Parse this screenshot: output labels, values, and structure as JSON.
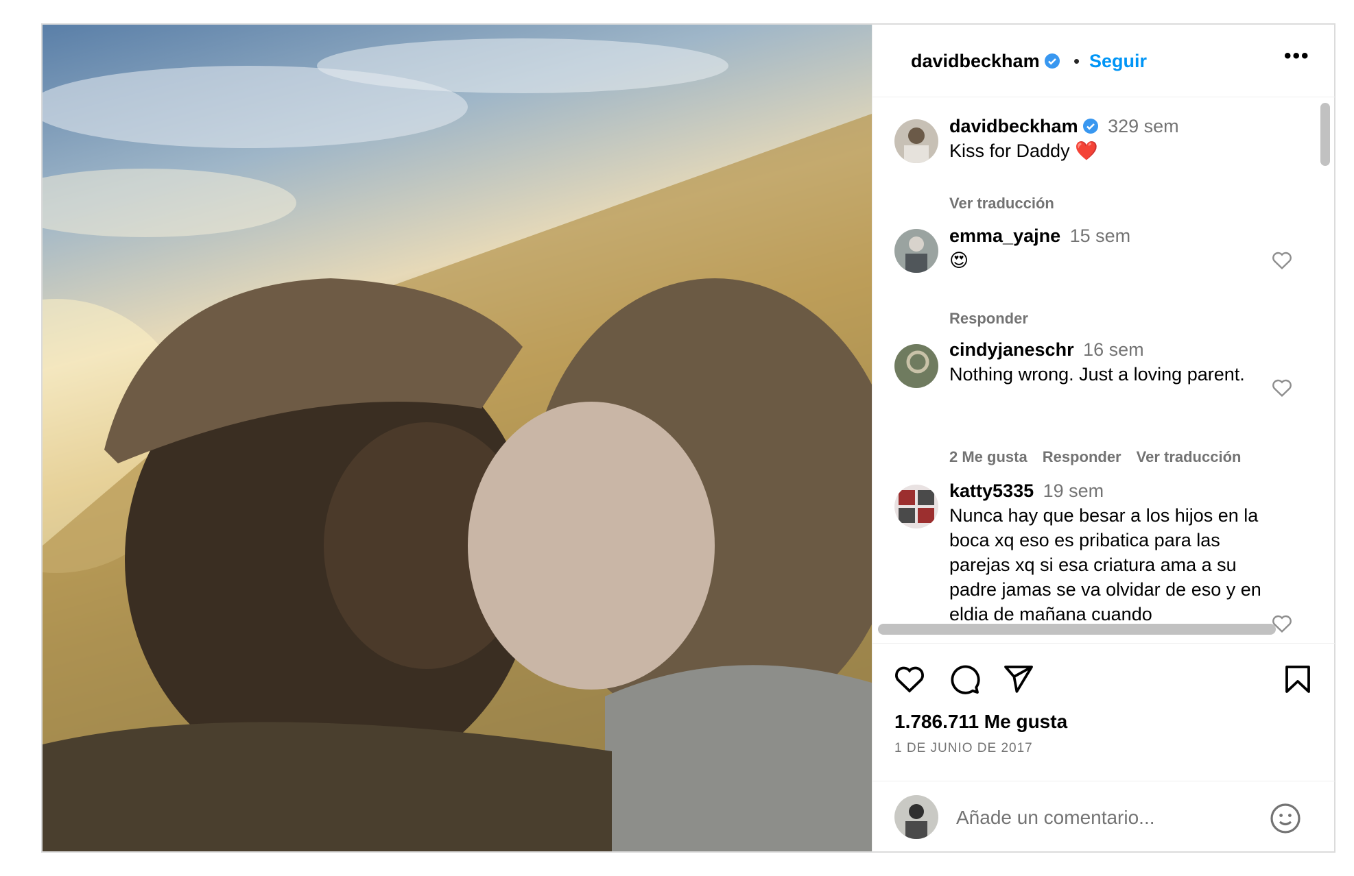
{
  "post": {
    "author": "davidbeckham",
    "separator": "•",
    "follow_label": "Seguir",
    "more_label": "•••"
  },
  "comments": [
    {
      "user": "davidbeckham",
      "time": "329 sem",
      "text": "Kiss for Daddy ❤️",
      "actions": [
        "Ver traducción"
      ],
      "verified": true
    },
    {
      "user": "emma_yajne",
      "time": "15 sem",
      "text": "😍",
      "actions": [
        "Responder"
      ]
    },
    {
      "user": "cindyjaneschr",
      "time": "16 sem",
      "text": "Nothing wrong. Just a loving parent.",
      "actions": [
        "2 Me gusta",
        "Responder",
        "Ver traducción"
      ]
    },
    {
      "user": "katty5335",
      "time": "19 sem",
      "text": "Nunca hay que besar a los hijos en la boca xq eso es pribatica para las parejas xq si esa criatura ama a su padre jamas se va olvidar de eso y en eldia de mañana cuando"
    }
  ],
  "footer": {
    "likes": "1.786.711 Me gusta",
    "date": "1 DE JUNIO DE 2017",
    "comment_placeholder": "Añade un comentario..."
  },
  "icons": [
    "heart-icon",
    "comment-icon",
    "share-icon",
    "bookmark-icon",
    "emoji-icon",
    "verified-badge-icon"
  ],
  "colors": {
    "link": "#0095f6",
    "verified": "#3897f0",
    "muted": "#737373",
    "border": "#dbdbdb"
  }
}
